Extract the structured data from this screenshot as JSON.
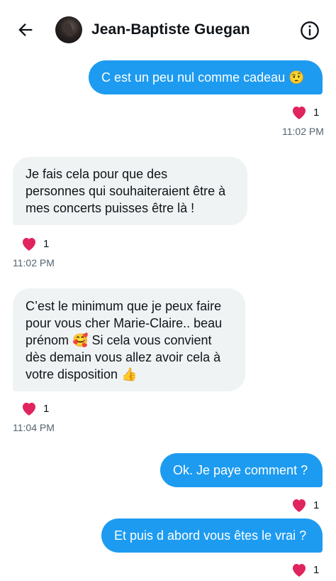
{
  "header": {
    "contact_name": "Jean-Baptiste Guegan",
    "back_icon": "arrow-left-icon",
    "info_icon": "info-circle-icon"
  },
  "colors": {
    "outgoing": "#1d9bf0",
    "incoming": "#eff3f4",
    "heart": "#f91880"
  },
  "messages": [
    {
      "direction": "outgoing",
      "text": "C est un peu nul comme cadeau 🤨",
      "likes": "1",
      "time": "11:02 PM"
    },
    {
      "direction": "incoming",
      "lines": [
        "Je fais cela pour que des",
        "personnes qui souhaiteraient être à",
        "mes concerts puisses être là !"
      ],
      "likes": "1",
      "time": "11:02 PM"
    },
    {
      "direction": "incoming",
      "lines": [
        "C’est le minimum que je peux faire",
        "pour vous cher  Marie-Claire.. beau",
        "prénom 🥰 Si cela vous convient",
        "dès demain vous allez avoir cela à",
        "votre disposition 👍"
      ],
      "likes": "1",
      "time": "11:04 PM"
    },
    {
      "direction": "outgoing",
      "text": "Ok. Je paye comment ?",
      "likes": "1"
    },
    {
      "direction": "outgoing",
      "text": "Et puis d abord vous êtes le vrai ?",
      "likes": "1"
    }
  ]
}
